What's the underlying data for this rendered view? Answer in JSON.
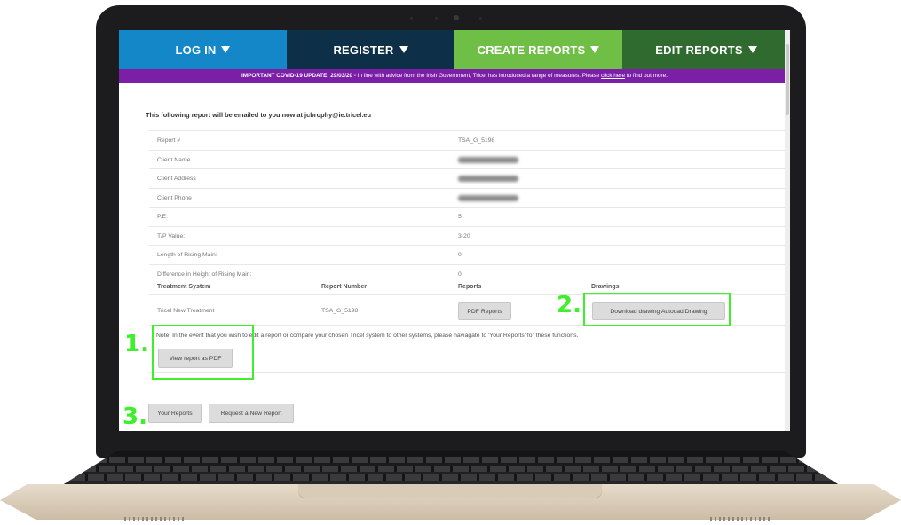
{
  "nav": {
    "items": [
      {
        "label": "LOG IN",
        "color": "#1387c7"
      },
      {
        "label": "REGISTER",
        "color": "#0d2f48"
      },
      {
        "label": "CREATE REPORTS",
        "color": "#6fbe45"
      },
      {
        "label": "EDIT REPORTS",
        "color": "#2f6a2e"
      }
    ]
  },
  "banner": {
    "bold": "IMPORTANT COVID-19 UPDATE: 29/03/20 -",
    "text": " In line with advice from the Irish Government, Tricel has introduced a range of measures. Please ",
    "link": "click here",
    "tail": " to find out more."
  },
  "intro": "This following report will be emailed to you now at jcbrophy@ie.tricel.eu",
  "report_rows": [
    {
      "label": "Report #",
      "value": "TSA_G_5198"
    },
    {
      "label": "Client Name",
      "value": ""
    },
    {
      "label": "Client Address",
      "value": ""
    },
    {
      "label": "Client Phone",
      "value": ""
    },
    {
      "label": "P.E:",
      "value": "5"
    },
    {
      "label": "T/P Value:",
      "value": "3-20"
    },
    {
      "label": "Length of Rising Main:",
      "value": "0"
    },
    {
      "label": "Difference in Height of Rising Main:",
      "value": "0"
    }
  ],
  "table": {
    "headers": [
      "Treatment System",
      "Report Number",
      "Reports",
      "Drawings"
    ],
    "row": {
      "system": "Tricel New Treatment",
      "number": "TSA_G_5198"
    }
  },
  "buttons": {
    "pdf_reports": "PDF Reports",
    "download_drawing": "Download drawing Autocad Drawing",
    "view_pdf": "View report as PDF",
    "your_reports": "Your Reports",
    "request_new": "Request a New Report"
  },
  "note": "Note: In the event that you wish to edit a report or compare your chosen Tricel system to other systems, please naviagate to 'Your Reports' for these functions.",
  "annotations": {
    "one": "1.",
    "two": "2.",
    "three": "3."
  },
  "colors": {
    "highlight": "#3ef02a",
    "banner": "#7a1fa6"
  }
}
